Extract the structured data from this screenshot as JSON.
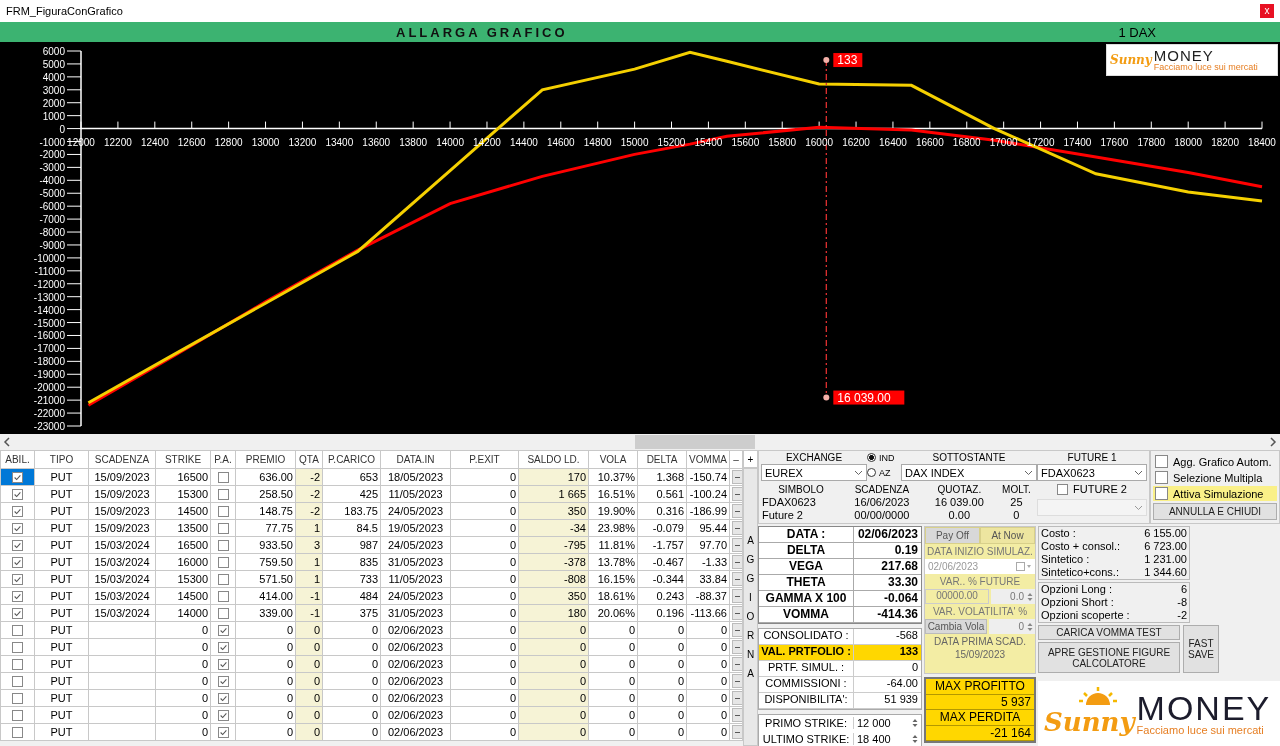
{
  "window": {
    "title": "FRM_FiguraConGrafico",
    "close": "x"
  },
  "header": {
    "button": "ALLARGA GRAFICO",
    "instrument": "1 DAX"
  },
  "chart": {
    "logo": {
      "brand_script": "Sunny",
      "brand": "MONEY",
      "tagline": "Facciamo luce sui mercati"
    },
    "chart_data": {
      "type": "line",
      "x": [
        12040,
        12500,
        13000,
        13500,
        14000,
        14500,
        15000,
        15300,
        15500,
        16000,
        16500,
        16950,
        17500,
        18000,
        18400
      ],
      "xlim": [
        12000,
        18400
      ],
      "ylim": [
        -23000,
        6000
      ],
      "xticks": [
        12000,
        12200,
        12400,
        12600,
        12800,
        13000,
        13200,
        13400,
        13600,
        13800,
        14000,
        14200,
        14400,
        14600,
        14800,
        15000,
        15200,
        15400,
        15600,
        15800,
        16000,
        16200,
        16400,
        16600,
        16800,
        17000,
        17200,
        17400,
        17600,
        17800,
        18000,
        18200,
        18400
      ],
      "yticks": [
        6000,
        5000,
        4000,
        3000,
        2000,
        1000,
        0,
        -1000,
        -2000,
        -3000,
        -4000,
        -5000,
        -6000,
        -7000,
        -8000,
        -9000,
        -10000,
        -11000,
        -12000,
        -13000,
        -14000,
        -15000,
        -16000,
        -17000,
        -18000,
        -19000,
        -20000,
        -21000,
        -22000,
        -23000
      ],
      "series": [
        {
          "color": "#ff0000",
          "values": [
            -21400,
            -17600,
            -13400,
            -9400,
            -5800,
            -3700,
            -2000,
            -1200,
            -600,
            100,
            -100,
            -900,
            -2200,
            -3400,
            -4500
          ]
        },
        {
          "color": "#f5d000",
          "values": [
            -21200,
            -17500,
            -13500,
            -9500,
            -3250,
            3000,
            4600,
            5900,
            5200,
            3450,
            3350,
            0,
            -3500,
            -4900,
            -5600
          ]
        }
      ],
      "ref_lines": [
        {
          "axis": "x",
          "value": 16039,
          "color": "#e03030"
        }
      ],
      "annotations": [
        {
          "x": 16039,
          "y": 5300,
          "text": "133"
        },
        {
          "x": 16039,
          "y": -20800,
          "text": "16 039.00"
        }
      ]
    }
  },
  "table": {
    "columns": [
      "ABIL.",
      "TIPO",
      "SCADENZA",
      "STRIKE",
      "P.A.",
      "PREMIO",
      "QTA",
      "P.CARICO",
      "DATA.IN",
      "P.EXIT",
      "SALDO LD.",
      "VOLA",
      "DELTA",
      "VOMMA",
      "–"
    ],
    "add_button": "+",
    "refresh_button": "AGGIORNA",
    "rows": [
      {
        "selected": true,
        "abil": true,
        "tipo": "PUT",
        "scadenza": "15/09/2023",
        "strike": "16500",
        "pa": false,
        "premio": "636.00",
        "qta": "-2",
        "pcarico": "653",
        "data_in": "18/05/2023",
        "pexit": "0",
        "saldo": "170",
        "vola": "10.37%",
        "delta": "1.368",
        "vomma": "-150.74",
        "remove": "–"
      },
      {
        "selected": false,
        "abil": true,
        "tipo": "PUT",
        "scadenza": "15/09/2023",
        "strike": "15300",
        "pa": false,
        "premio": "258.50",
        "qta": "-2",
        "pcarico": "425",
        "data_in": "11/05/2023",
        "pexit": "0",
        "saldo": "1 665",
        "vola": "16.51%",
        "delta": "0.561",
        "vomma": "-100.24",
        "remove": "–"
      },
      {
        "selected": false,
        "abil": true,
        "tipo": "PUT",
        "scadenza": "15/09/2023",
        "strike": "14500",
        "pa": false,
        "premio": "148.75",
        "qta": "-2",
        "pcarico": "183.75",
        "data_in": "24/05/2023",
        "pexit": "0",
        "saldo": "350",
        "vola": "19.90%",
        "delta": "0.316",
        "vomma": "-186.99",
        "remove": "–"
      },
      {
        "selected": false,
        "abil": true,
        "tipo": "PUT",
        "scadenza": "15/09/2023",
        "strike": "13500",
        "pa": false,
        "premio": "77.75",
        "qta": "1",
        "pcarico": "84.5",
        "data_in": "19/05/2023",
        "pexit": "0",
        "saldo": "-34",
        "vola": "23.98%",
        "delta": "-0.079",
        "vomma": "95.44",
        "remove": "–"
      },
      {
        "selected": false,
        "abil": true,
        "tipo": "PUT",
        "scadenza": "15/03/2024",
        "strike": "16500",
        "pa": false,
        "premio": "933.50",
        "qta": "3",
        "pcarico": "987",
        "data_in": "24/05/2023",
        "pexit": "0",
        "saldo": "-795",
        "vola": "11.81%",
        "delta": "-1.757",
        "vomma": "97.70",
        "remove": "–"
      },
      {
        "selected": false,
        "abil": true,
        "tipo": "PUT",
        "scadenza": "15/03/2024",
        "strike": "16000",
        "pa": false,
        "premio": "759.50",
        "qta": "1",
        "pcarico": "835",
        "data_in": "31/05/2023",
        "pexit": "0",
        "saldo": "-378",
        "vola": "13.78%",
        "delta": "-0.467",
        "vomma": "-1.33",
        "remove": "–"
      },
      {
        "selected": false,
        "abil": true,
        "tipo": "PUT",
        "scadenza": "15/03/2024",
        "strike": "15300",
        "pa": false,
        "premio": "571.50",
        "qta": "1",
        "pcarico": "733",
        "data_in": "11/05/2023",
        "pexit": "0",
        "saldo": "-808",
        "vola": "16.15%",
        "delta": "-0.344",
        "vomma": "33.84",
        "remove": "–"
      },
      {
        "selected": false,
        "abil": true,
        "tipo": "PUT",
        "scadenza": "15/03/2024",
        "strike": "14500",
        "pa": false,
        "premio": "414.00",
        "qta": "-1",
        "pcarico": "484",
        "data_in": "24/05/2023",
        "pexit": "0",
        "saldo": "350",
        "vola": "18.61%",
        "delta": "0.243",
        "vomma": "-88.37",
        "remove": "–"
      },
      {
        "selected": false,
        "abil": true,
        "tipo": "PUT",
        "scadenza": "15/03/2024",
        "strike": "14000",
        "pa": false,
        "premio": "339.00",
        "qta": "-1",
        "pcarico": "375",
        "data_in": "31/05/2023",
        "pexit": "0",
        "saldo": "180",
        "vola": "20.06%",
        "delta": "0.196",
        "vomma": "-113.66",
        "remove": "–"
      },
      {
        "selected": false,
        "abil": false,
        "tipo": "PUT",
        "strike": "0",
        "pa": true,
        "premio": "0",
        "qta": "0",
        "pcarico": "0",
        "data_in": "02/06/2023",
        "pexit": "0",
        "saldo": "0",
        "vola": "0",
        "delta": "0",
        "vomma": "0",
        "remove": "–"
      },
      {
        "selected": false,
        "abil": false,
        "tipo": "PUT",
        "strike": "0",
        "pa": true,
        "premio": "0",
        "qta": "0",
        "pcarico": "0",
        "data_in": "02/06/2023",
        "pexit": "0",
        "saldo": "0",
        "vola": "0",
        "delta": "0",
        "vomma": "0",
        "remove": "–"
      },
      {
        "selected": false,
        "abil": false,
        "tipo": "PUT",
        "strike": "0",
        "pa": true,
        "premio": "0",
        "qta": "0",
        "pcarico": "0",
        "data_in": "02/06/2023",
        "pexit": "0",
        "saldo": "0",
        "vola": "0",
        "delta": "0",
        "vomma": "0",
        "remove": "–"
      },
      {
        "selected": false,
        "abil": false,
        "tipo": "PUT",
        "strike": "0",
        "pa": true,
        "premio": "0",
        "qta": "0",
        "pcarico": "0",
        "data_in": "02/06/2023",
        "pexit": "0",
        "saldo": "0",
        "vola": "0",
        "delta": "0",
        "vomma": "0",
        "remove": "–"
      },
      {
        "selected": false,
        "abil": false,
        "tipo": "PUT",
        "strike": "0",
        "pa": true,
        "premio": "0",
        "qta": "0",
        "pcarico": "0",
        "data_in": "02/06/2023",
        "pexit": "0",
        "saldo": "0",
        "vola": "0",
        "delta": "0",
        "vomma": "0",
        "remove": "–"
      },
      {
        "selected": false,
        "abil": false,
        "tipo": "PUT",
        "strike": "0",
        "pa": true,
        "premio": "0",
        "qta": "0",
        "pcarico": "0",
        "data_in": "02/06/2023",
        "pexit": "0",
        "saldo": "0",
        "vola": "0",
        "delta": "0",
        "vomma": "0",
        "remove": "–"
      },
      {
        "selected": false,
        "abil": false,
        "tipo": "PUT",
        "strike": "0",
        "pa": true,
        "premio": "0",
        "qta": "0",
        "pcarico": "0",
        "data_in": "02/06/2023",
        "pexit": "0",
        "saldo": "0",
        "vola": "0",
        "delta": "0",
        "vomma": "0",
        "remove": "–"
      }
    ]
  },
  "setup": {
    "exchange_label": "EXCHANGE",
    "exchange": "EUREX",
    "index_types": [
      {
        "label": "IND",
        "selected": true
      },
      {
        "label": "AZ",
        "selected": false
      }
    ],
    "underlying_label": "SOTTOSTANTE",
    "underlying": "DAX INDEX",
    "future1_label": "FUTURE 1",
    "future1": "FDAX0623",
    "future2": {
      "label": "FUTURE 2",
      "checked": false,
      "disabled": true
    },
    "symbols": {
      "columns": [
        "SIMBOLO",
        "SCADENZA",
        "QUOTAZ.",
        "MOLT."
      ],
      "rows": [
        [
          "FDAX0623",
          "16/06/2023",
          "16 039.00",
          "25"
        ],
        [
          "Future 2",
          "00/00/0000",
          "0.00",
          "0"
        ]
      ]
    }
  },
  "options": [
    {
      "label": "Agg. Grafico Autom.",
      "checked": false,
      "highlighted": false
    },
    {
      "label": "Selezione Multipla",
      "checked": false,
      "highlighted": false
    },
    {
      "label": "Attiva Simulazione",
      "checked": false,
      "highlighted": true
    }
  ],
  "cancel_button": "ANNULLA E CHIUDI",
  "greeks": [
    {
      "label": "DATA :",
      "value": "02/06/2023"
    },
    {
      "label": "DELTA",
      "value": "0.19"
    },
    {
      "label": "VEGA",
      "value": "217.68"
    },
    {
      "label": "THETA",
      "value": "33.30"
    },
    {
      "label": "GAMMA X 100",
      "value": "-0.064"
    },
    {
      "label": "VOMMA",
      "value": "-414.36"
    }
  ],
  "summary": [
    {
      "label": "CONSOLIDATO :",
      "value": "-568",
      "highlighted": false
    },
    {
      "label": "VAL. PRTFOLIO :",
      "value": "133",
      "highlighted": true
    },
    {
      "label": "PRTF. SIMUL. :",
      "value": "0",
      "highlighted": false
    },
    {
      "label": "COMMISSIONI :",
      "value": "-64.00",
      "highlighted": false
    },
    {
      "label": "DISPONIBILITA':",
      "value": "51 939",
      "highlighted": false
    }
  ],
  "strikes": [
    {
      "label": "PRIMO STRIKE:",
      "value": "12 000"
    },
    {
      "label": "ULTIMO STRIKE:",
      "value": "18 400"
    }
  ],
  "simulation": {
    "tabs": [
      {
        "label": "Pay Off",
        "selected": true
      },
      {
        "label": "At Now",
        "selected": false
      }
    ],
    "start_label": "DATA INIZIO SIMULAZ.",
    "start_date": {
      "value": "02/06/2023",
      "disabled": true
    },
    "future_var_label": "VAR.. % FUTURE",
    "future_price": "00000.00",
    "future_var": "0.0",
    "vol_var_label": "VAR. VOLATILITA' %",
    "vol_button": "Cambia Vola",
    "vol_var": "0",
    "first_expiry_label": "DATA PRIMA SCAD.",
    "first_expiry": "15/09/2023"
  },
  "max": {
    "profit_label": "MAX PROFITTO",
    "profit": "5 937",
    "loss_label": "MAX PERDITA",
    "loss": "-21 164"
  },
  "costs": [
    {
      "label": "Costo :",
      "value": "6 155.00"
    },
    {
      "label": "Costo + consol.:",
      "value": "6 723.00"
    },
    {
      "label": "Sintetico :",
      "value": "1 231.00"
    },
    {
      "label": "Sintetico+cons.:",
      "value": "1 344.60"
    }
  ],
  "counts": [
    {
      "label": "Opzioni Long :",
      "value": "6"
    },
    {
      "label": "Opzioni Short :",
      "value": "-8"
    },
    {
      "label": "Opzioni scoperte :",
      "value": "-2"
    }
  ],
  "buttons": {
    "vomma_test": "CARICA VOMMA TEST",
    "figures": "APRE GESTIONE FIGURE CALCOLATORE",
    "fast_save": "FAST SAVE"
  },
  "logo": {
    "brand_script": "Sunny",
    "brand": "MONEY",
    "tagline": "Facciamo luce sui mercati"
  }
}
